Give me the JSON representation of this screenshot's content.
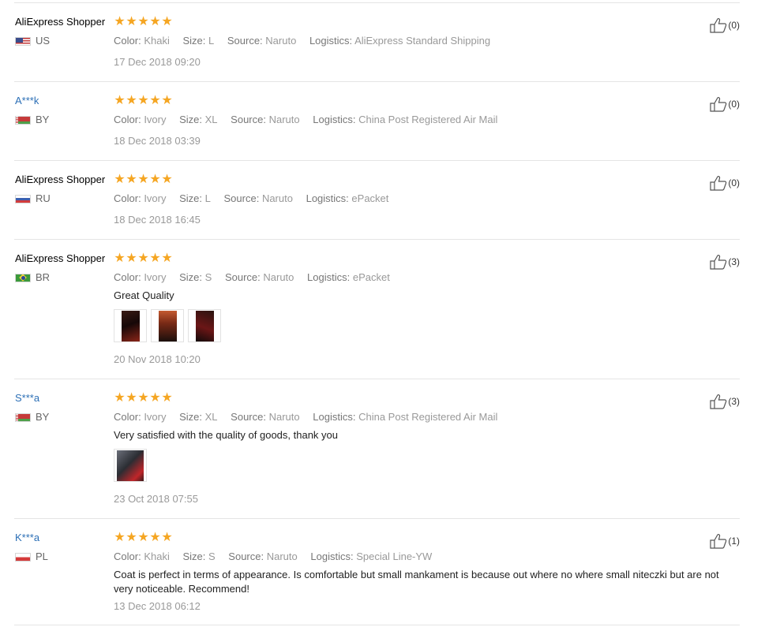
{
  "attr_labels": {
    "color": "Color:",
    "size": "Size:",
    "source": "Source:",
    "logistics": "Logistics:"
  },
  "reviews": [
    {
      "user": "AliExpress Shopper",
      "country": "US",
      "rating": 5,
      "color": "Khaki",
      "size": "L",
      "source": "Naruto",
      "logistics": "AliExpress Standard Shipping",
      "text": "",
      "photo_count": 0,
      "date": "17 Dec 2018 09:20",
      "helpful": "(0)"
    },
    {
      "user": "A***k",
      "country": "BY",
      "rating": 5,
      "color": "Ivory",
      "size": "XL",
      "source": "Naruto",
      "logistics": "China Post Registered Air Mail",
      "text": "",
      "photo_count": 0,
      "date": "18 Dec 2018 03:39",
      "helpful": "(0)"
    },
    {
      "user": "AliExpress Shopper",
      "country": "RU",
      "rating": 5,
      "color": "Ivory",
      "size": "L",
      "source": "Naruto",
      "logistics": "ePacket",
      "text": "",
      "photo_count": 0,
      "date": "18 Dec 2018 16:45",
      "helpful": "(0)"
    },
    {
      "user": "AliExpress Shopper",
      "country": "BR",
      "rating": 5,
      "color": "Ivory",
      "size": "S",
      "source": "Naruto",
      "logistics": "ePacket",
      "text": "Great Quality",
      "photo_count": 3,
      "date": "20 Nov 2018 10:20",
      "helpful": "(3)"
    },
    {
      "user": "S***a",
      "country": "BY",
      "rating": 5,
      "color": "Ivory",
      "size": "XL",
      "source": "Naruto",
      "logistics": "China Post Registered Air Mail",
      "text": "Very satisfied with the quality of goods, thank you",
      "photo_count": 1,
      "date": "23 Oct 2018 07:55",
      "helpful": "(3)"
    },
    {
      "user": "K***a",
      "country": "PL",
      "rating": 5,
      "color": "Khaki",
      "size": "S",
      "source": "Naruto",
      "logistics": "Special Line-YW",
      "text": "Coat is perfect in terms of appearance. Is comfortable but small mankament is because out where no where small niteczki but are not very noticeable. Recommend!",
      "photo_count": 0,
      "date": "13 Dec 2018 06:12",
      "helpful": "(1)"
    }
  ],
  "icons": {
    "star": "star-icon",
    "helpful": "thumbs-up-icon"
  },
  "colors": {
    "star": "#f5a623",
    "link_user": "#2c6fb6",
    "divider": "#e5e5e5"
  }
}
